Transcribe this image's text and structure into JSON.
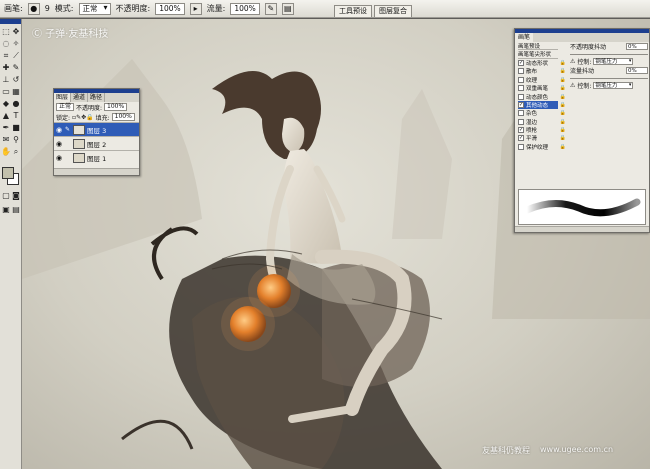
{
  "options_bar": {
    "brush_label": "画笔:",
    "brush_size": "9",
    "mode_label": "模式:",
    "mode_value": "正常",
    "opacity_label": "不透明度:",
    "opacity_value": "100%",
    "flow_label": "流量:",
    "flow_value": "100%"
  },
  "palette_well": {
    "tabs": [
      "工具预设",
      "图层复合"
    ]
  },
  "canvas": {
    "copyright": "Ⓒ 子弹·友基科技",
    "watermark_cn": "友基科仍教程",
    "watermark_url": "www.ugee.com.cn"
  },
  "layers_panel": {
    "tabs": [
      "图层",
      "通道",
      "路径"
    ],
    "blend_mode": "正常",
    "opacity_label": "不透明度:",
    "opacity_value": "100%",
    "lock_label": "锁定:",
    "fill_label": "填充:",
    "fill_value": "100%",
    "layers": [
      {
        "name": "图层 3",
        "selected": true
      },
      {
        "name": "图层 2",
        "selected": false
      },
      {
        "name": "图层 1",
        "selected": false
      }
    ]
  },
  "brushes_panel": {
    "tab": "画笔",
    "list_header": "画笔预设",
    "list_subheader": "画笔笔尖形状",
    "options": [
      {
        "label": "动态形状",
        "checked": true,
        "highlight": false
      },
      {
        "label": "散布",
        "checked": false,
        "highlight": false
      },
      {
        "label": "纹理",
        "checked": false,
        "highlight": false
      },
      {
        "label": "双重画笔",
        "checked": false,
        "highlight": false
      },
      {
        "label": "动态颜色",
        "checked": false,
        "highlight": false
      },
      {
        "label": "其他动态",
        "checked": true,
        "highlight": true
      },
      {
        "label": "杂色",
        "checked": false,
        "highlight": false
      },
      {
        "label": "湿边",
        "checked": false,
        "highlight": false
      },
      {
        "label": "喷枪",
        "checked": true,
        "highlight": false
      },
      {
        "label": "平滑",
        "checked": true,
        "highlight": false
      },
      {
        "label": "保护纹理",
        "checked": false,
        "highlight": false
      }
    ],
    "opacity_jitter_label": "不透明度抖动",
    "opacity_jitter_value": "0%",
    "control_label": "控制:",
    "control_value": "钢笔压力",
    "flow_jitter_label": "流量抖动",
    "flow_jitter_value": "0%",
    "control2_value": "钢笔压力"
  },
  "colors": {
    "title_bar": "#1d3f8f",
    "selection": "#2f5cb7",
    "orb": "#e07a24"
  }
}
